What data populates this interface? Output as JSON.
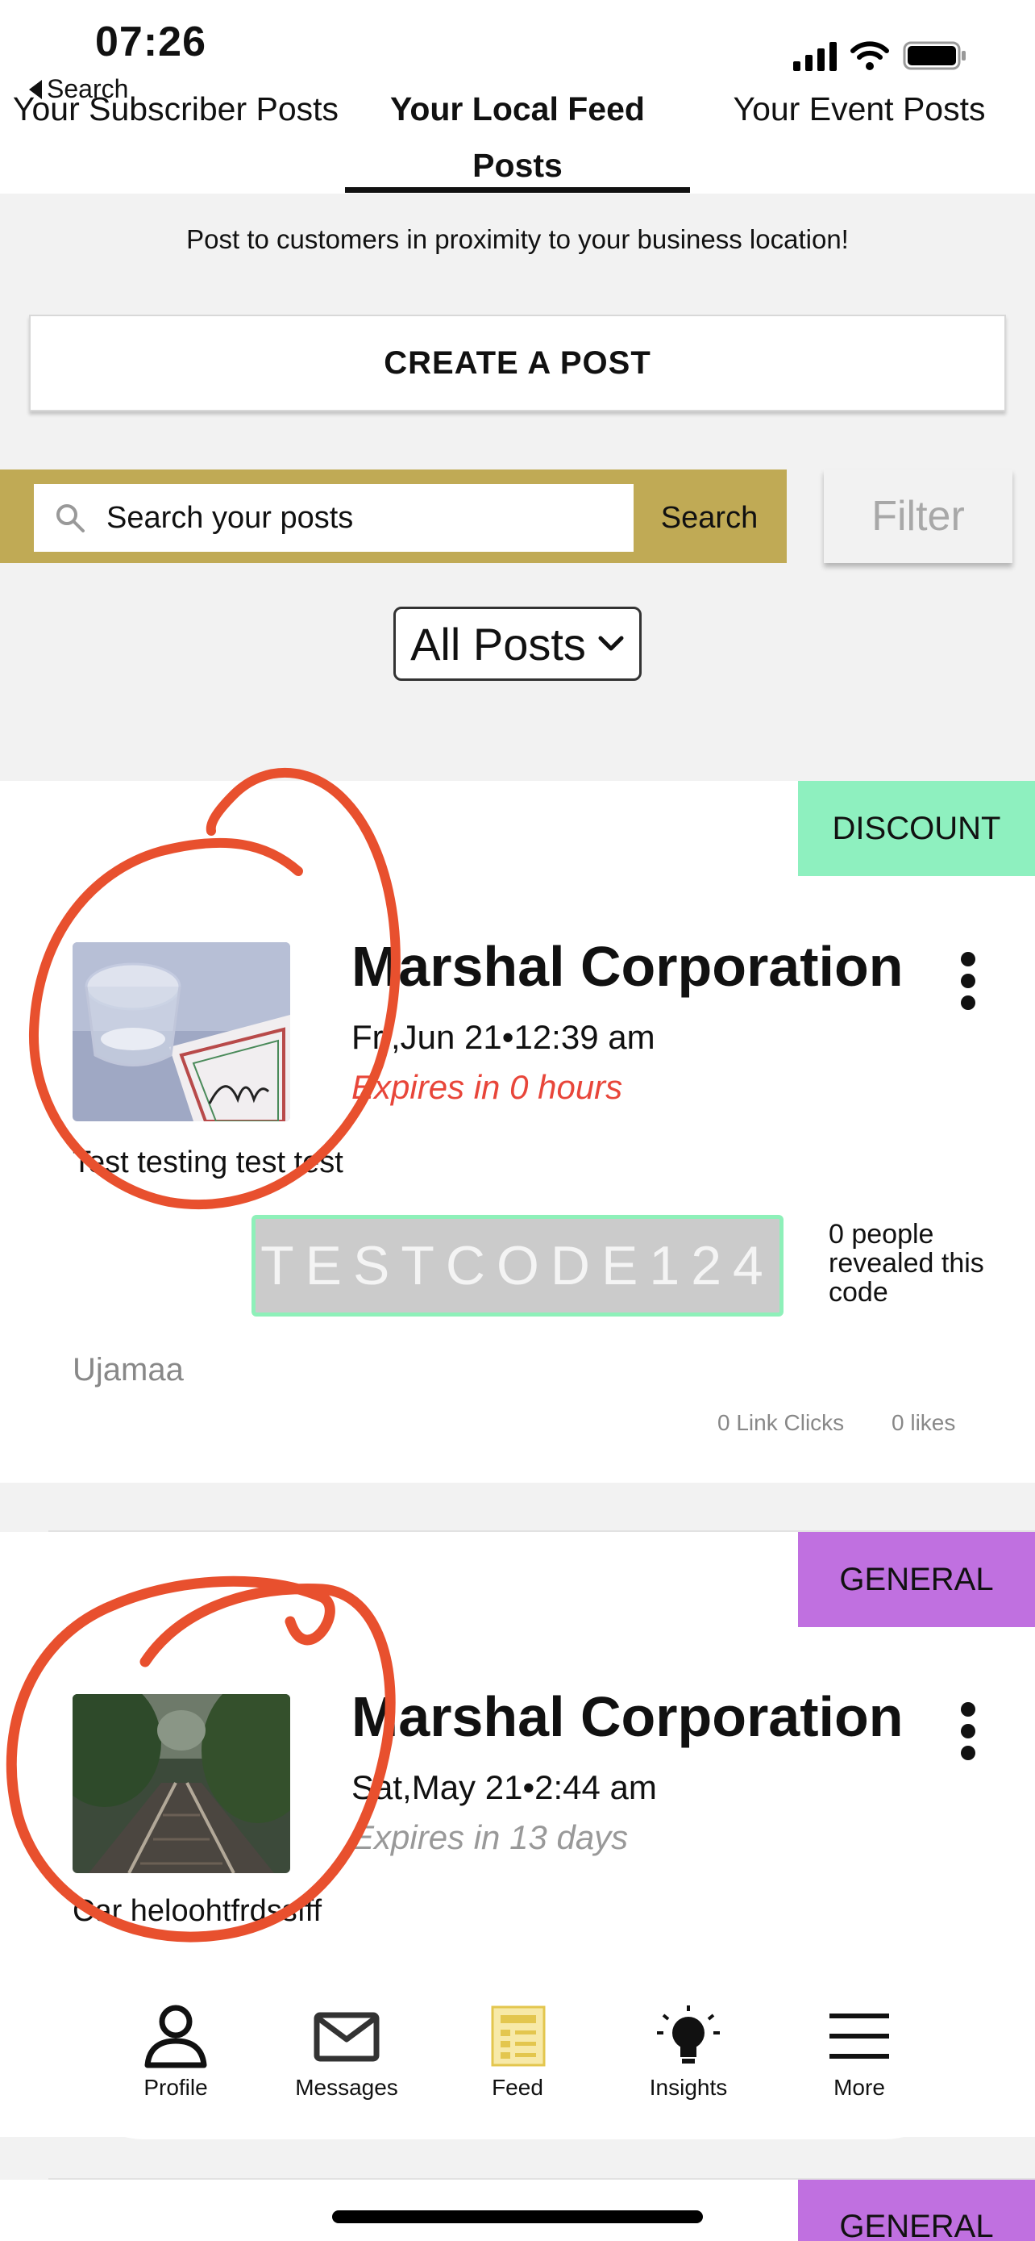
{
  "status_bar": {
    "time": "07:26",
    "back_label": "Search"
  },
  "tabs": [
    {
      "label": "Your Subscriber Posts"
    },
    {
      "label": "Your Local Feed Posts"
    },
    {
      "label": "Your Event Posts"
    }
  ],
  "intro_text": "Post to customers in proximity to your business location!",
  "create_button": "CREATE A POST",
  "search": {
    "placeholder": "Search your posts",
    "button": "Search"
  },
  "filter_button": "Filter",
  "post_filter": {
    "selected": "All Posts"
  },
  "posts": [
    {
      "badge": "DISCOUNT",
      "badge_color": "#8ef0bf",
      "business": "Marshal Corporation",
      "date": "Fri,Jun 21•12:39 am",
      "expires": "Expires in 0 hours",
      "expires_color": "#e8463a",
      "caption": "Test testing test test",
      "code": "TESTCODE124",
      "reveal_text": "0 people revealed this code",
      "business_tag": "Ujamaa",
      "link_clicks": "0 Link Clicks",
      "likes": "0 likes"
    },
    {
      "badge": "GENERAL",
      "badge_color": "#c070e0",
      "business": "Marshal Corporation",
      "date": "Sat,May 21•2:44 am",
      "expires": "Expires in 13 days",
      "expires_color": "#999999",
      "caption": "Car heloohtfrdssfff"
    },
    {
      "badge": "GENERAL",
      "badge_color": "#c070e0"
    }
  ],
  "bottom_nav": [
    {
      "label": "Profile",
      "icon": "person-icon"
    },
    {
      "label": "Messages",
      "icon": "envelope-icon"
    },
    {
      "label": "Feed",
      "icon": "feed-icon"
    },
    {
      "label": "Insights",
      "icon": "lightbulb-icon"
    },
    {
      "label": "More",
      "icon": "menu-icon"
    }
  ],
  "colors": {
    "accent_gold": "#c0aa55",
    "annotation_red": "#e8502e"
  }
}
